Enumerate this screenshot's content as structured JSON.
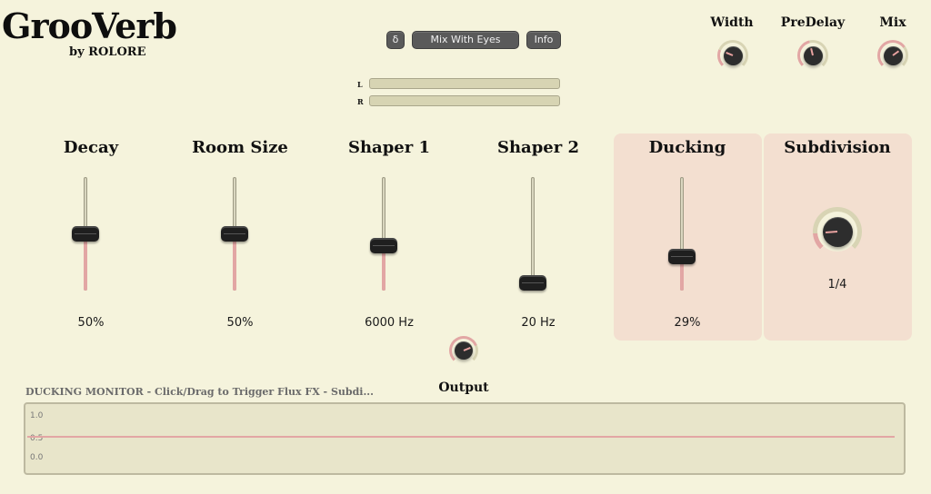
{
  "header": {
    "title": "GrooVerb",
    "subtitle": "by ROLORE",
    "delta_label": "δ",
    "preset_name": "Mix With Eyes",
    "info_label": "Info"
  },
  "meters": {
    "left_label": "L",
    "right_label": "R"
  },
  "top_knobs": [
    {
      "label": "Width",
      "level": 0.25
    },
    {
      "label": "PreDelay",
      "level": 0.45
    },
    {
      "label": "Mix",
      "level": 0.7
    }
  ],
  "sliders": [
    {
      "label": "Decay",
      "value": "50%",
      "level": 0.5
    },
    {
      "label": "Room Size",
      "value": "50%",
      "level": 0.5
    },
    {
      "label": "Shaper 1",
      "value": "6000 Hz",
      "level": 0.38
    },
    {
      "label": "Shaper 2",
      "value": "20 Hz",
      "level": 0.0
    },
    {
      "label": "Ducking",
      "value": "29%",
      "level": 0.27
    }
  ],
  "subdivision": {
    "label": "Subdivision",
    "value": "1/4",
    "level": 0.15
  },
  "output": {
    "label": "Output",
    "level": 0.75
  },
  "monitor": {
    "title": "DUCKING MONITOR - Click/Drag to Trigger Flux FX - Subdi...",
    "ticks": [
      "1.0",
      "0.5",
      "0.0"
    ],
    "line_value": 0.5
  },
  "colors": {
    "background": "#f5f3dc",
    "accent": "#e2a6a4",
    "panel": "#f3dfd0"
  }
}
